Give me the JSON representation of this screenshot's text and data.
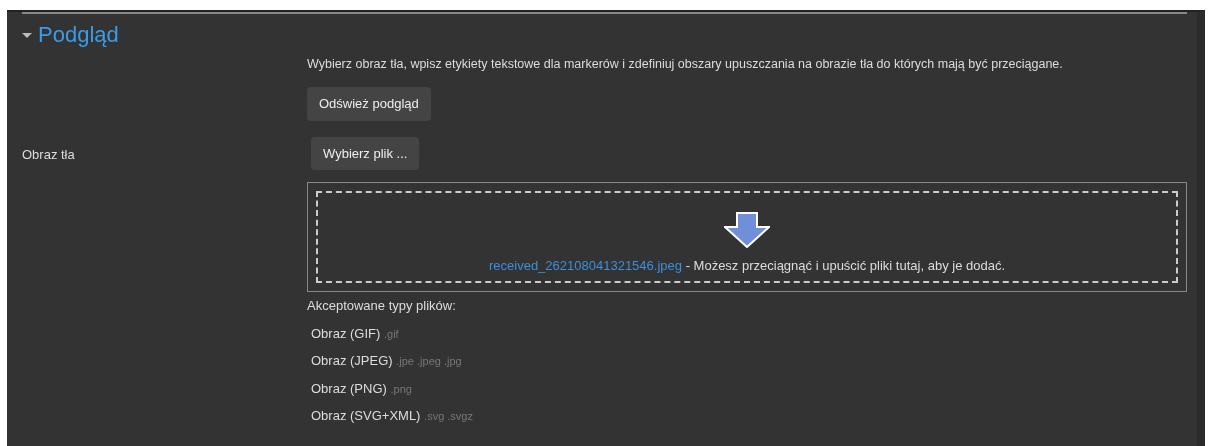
{
  "section": {
    "title": "Podgląd",
    "expanded": true
  },
  "description": "Wybierz obraz tła, wpisz etykiety tekstowe dla markerów i zdefiniuj obszary upuszczania na obrazie tła do których mają być przeciągane.",
  "refresh_button": "Odśwież podgląd",
  "background_field": {
    "label": "Obraz tła",
    "choose_button": "Wybierz plik ...",
    "file_link": "received_262108041321546.jpeg",
    "drop_hint": "- Możesz przeciągnąć i upuścić pliki tutaj, aby je dodać."
  },
  "accepted_types": {
    "heading": "Akceptowane typy plików:",
    "types": [
      {
        "name": "Obraz (GIF)",
        "extensions": ".gif"
      },
      {
        "name": "Obraz (JPEG)",
        "extensions": ".jpe .jpeg .jpg"
      },
      {
        "name": "Obraz (PNG)",
        "extensions": ".png"
      },
      {
        "name": "Obraz (SVG+XML)",
        "extensions": ".svg .svgz"
      }
    ]
  }
}
